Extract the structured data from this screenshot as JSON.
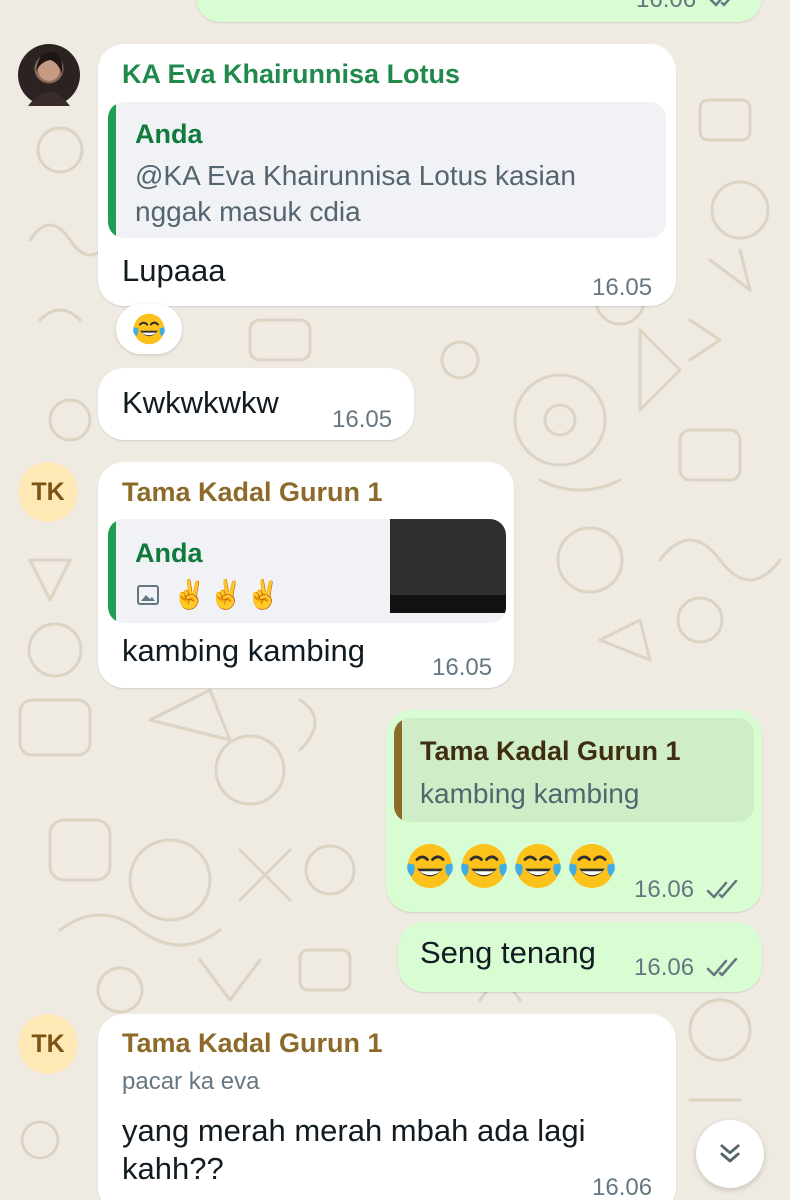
{
  "colors": {
    "background": "#efeae2",
    "incoming_bubble": "#ffffff",
    "outgoing_bubble": "#d9fdd3",
    "sender_eva": "#1f8a4c",
    "sender_tama": "#8c6a2a",
    "quote_you": "#0f7a3c",
    "tick": "#667781"
  },
  "messages": [
    {
      "sender": "KA Eva Khairunnisa Lotus",
      "avatar": "profile-photo",
      "quote": {
        "name": "Anda",
        "text_line1": "@KA Eva Khairunnisa Lotus kasian",
        "text_line2": "nggak masuk cdia"
      },
      "text": "Lupaaa",
      "time": "16.05",
      "reaction": "face-with-tears-of-joy"
    },
    {
      "text": "Kwkwkwkw",
      "time": "16.05"
    },
    {
      "sender": "Tama Kadal Gurun 1",
      "avatar_initials": "TK",
      "quote": {
        "name": "Anda",
        "icon": "image-icon",
        "emojis": "✌️✌️✌️",
        "has_thumbnail": true
      },
      "text": "kambing kambing",
      "time": "16.05"
    },
    {
      "outgoing": true,
      "quote": {
        "name": "Tama Kadal Gurun 1",
        "text": "kambing kambing"
      },
      "emoji_count": 4,
      "time": "16.06",
      "status": "read"
    },
    {
      "outgoing": true,
      "text": "Seng tenang",
      "time": "16.06",
      "status": "read"
    },
    {
      "sender": "Tama Kadal Gurun 1",
      "avatar_initials": "TK",
      "sender_subtitle": "pacar ka eva",
      "text_line1": "yang merah merah mbah ada lagi",
      "text_line2": "kahh??",
      "time": "16.06"
    }
  ],
  "top_partial": {
    "time": "16.06"
  },
  "scroll_button": {
    "icon": "double-chevron-down-icon"
  }
}
